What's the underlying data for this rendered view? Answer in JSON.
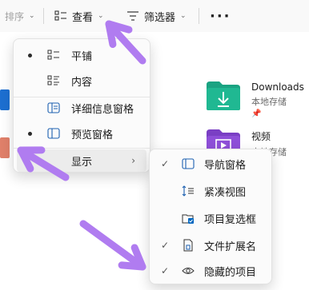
{
  "toolbar": {
    "sort_label": "排序",
    "view_label": "查看",
    "filter_label": "筛选器",
    "more_label": "···"
  },
  "files": [
    {
      "name": "Downloads",
      "sub": "本地存储"
    },
    {
      "name": "视频",
      "sub": "本地存储"
    }
  ],
  "view_menu": {
    "items": [
      {
        "label": "平铺",
        "selected": true,
        "icon": "tiles-icon"
      },
      {
        "label": "内容",
        "selected": false,
        "icon": "content-icon"
      },
      {
        "label": "详细信息窗格",
        "selected": false,
        "icon": "details-pane-icon"
      },
      {
        "label": "预览窗格",
        "selected": true,
        "icon": "preview-pane-icon"
      },
      {
        "label": "显示",
        "has_submenu": true
      }
    ]
  },
  "show_submenu": {
    "items": [
      {
        "label": "导航窗格",
        "checked": true,
        "icon": "navigation-pane-icon"
      },
      {
        "label": "紧凑视图",
        "checked": false,
        "icon": "compact-view-icon"
      },
      {
        "label": "项目复选框",
        "checked": false,
        "icon": "item-checkbox-icon"
      },
      {
        "label": "文件扩展名",
        "checked": true,
        "icon": "file-extension-icon"
      },
      {
        "label": "隐藏的项目",
        "checked": true,
        "icon": "hidden-items-icon"
      }
    ]
  },
  "colors": {
    "annotation_arrow": "#b07cf0",
    "accent": "#0067c0",
    "downloads_folder": "#1aa382",
    "videos_folder": "#7a3fc4"
  }
}
